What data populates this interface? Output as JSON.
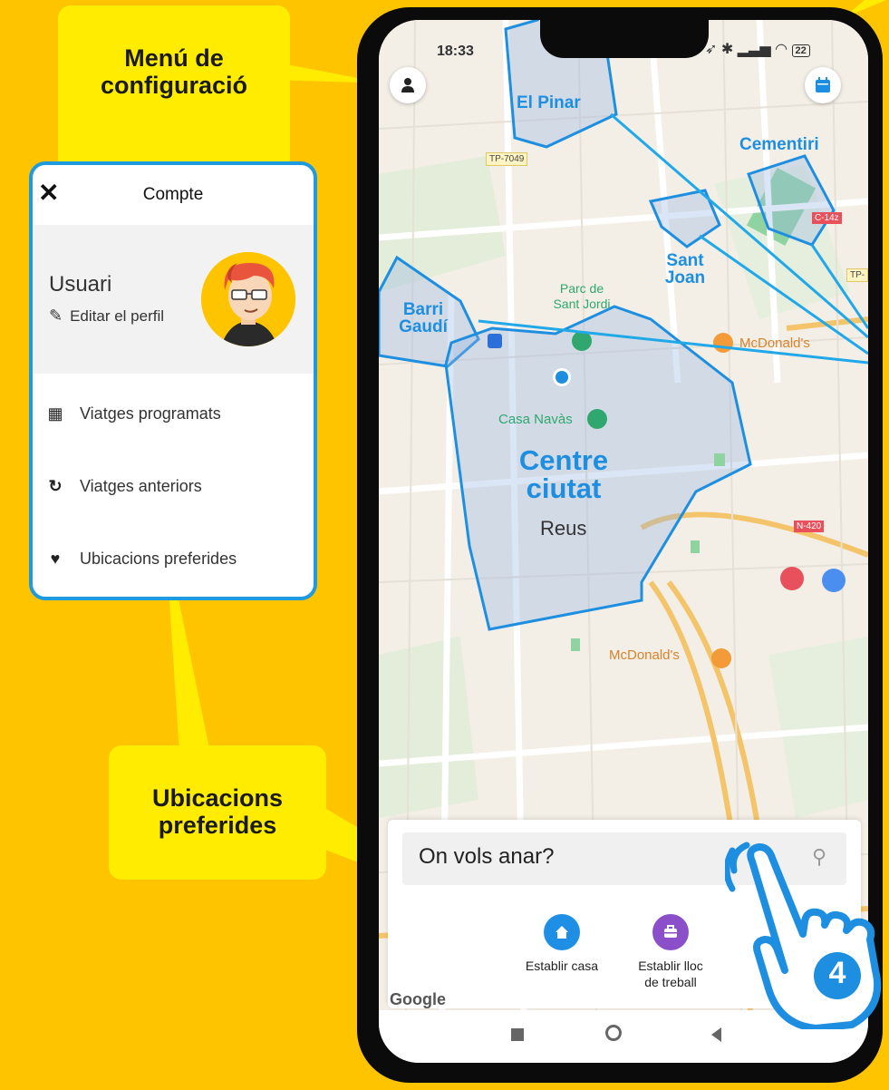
{
  "callouts": {
    "menu": "Menú de configuració",
    "ubicacions": "Ubicacions preferides"
  },
  "account": {
    "title": "Compte",
    "username": "Usuari",
    "edit_profile": "Editar el perfil",
    "items": [
      {
        "label": "Viatges programats",
        "icon": "calendar-icon"
      },
      {
        "label": "Viatges anteriors",
        "icon": "history-icon"
      },
      {
        "label": "Ubicacions preferides",
        "icon": "heart-icon"
      }
    ]
  },
  "phone": {
    "time": "18:33",
    "battery": "22"
  },
  "map": {
    "zones": [
      "El Pinar",
      "Cementiri",
      "Sant Joan",
      "Barri Gaudí",
      "Centre ciutat"
    ],
    "city": "Reus",
    "pois": [
      "Parc de Sant Jordi",
      "Casa Navàs",
      "McDonald's",
      "McDonald's"
    ],
    "roads": [
      "TP-7049",
      "C-14z",
      "N-420",
      "TP-"
    ],
    "google": "Google"
  },
  "search": {
    "placeholder": "On vols anar?"
  },
  "quick": {
    "home": "Establir casa",
    "work_line1": "Establir lloc",
    "work_line2": "de treball"
  },
  "step_badge": "4",
  "colors": {
    "background": "#FFC400",
    "callout": "#FFEC00",
    "accent_blue": "#1E8FE0",
    "home_button": "#1F8FE5",
    "work_button": "#8B4FC9"
  }
}
